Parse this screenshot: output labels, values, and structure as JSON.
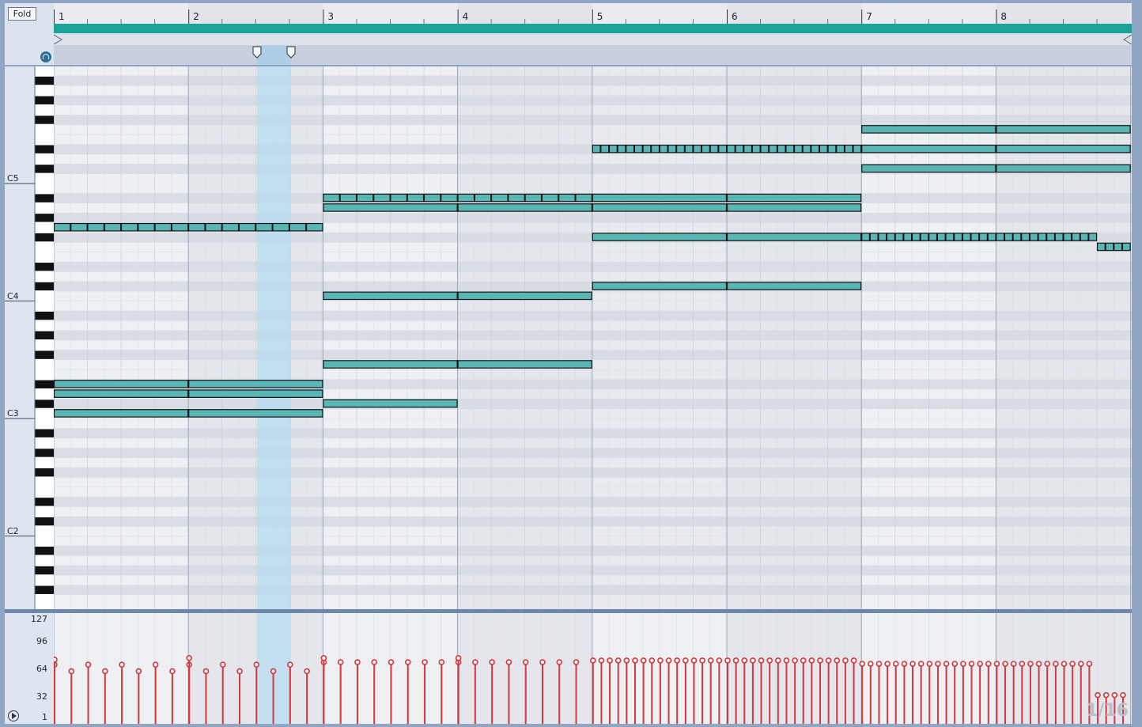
{
  "header": {
    "fold_label": "Fold"
  },
  "ruler": {
    "bars": [
      "1",
      "2",
      "3",
      "4",
      "5",
      "6",
      "7",
      "8"
    ]
  },
  "keyboard": {
    "octave_labels": [
      "C5",
      "C4",
      "C3",
      "C2"
    ]
  },
  "velocity": {
    "axis_labels": [
      "127",
      "96",
      "64",
      "32",
      "1"
    ]
  },
  "grid_quantization": "1/16",
  "icons": [
    "headphones-icon",
    "play-icon",
    "loop-start-icon",
    "loop-end-icon",
    "start-marker-icon",
    "end-marker-icon"
  ],
  "colors": {
    "note": "#5ab6b5",
    "loop": "#1aa39b",
    "velocity": "#d2393c",
    "selection": "#bfe1f3"
  },
  "notes": [
    {
      "pitch": "G4",
      "start": 1,
      "end": 3,
      "split": 16
    },
    {
      "pitch": "D#3",
      "start": 1,
      "end": 2
    },
    {
      "pitch": "D#3",
      "start": 2,
      "end": 3
    },
    {
      "pitch": "D3",
      "start": 1,
      "end": 2
    },
    {
      "pitch": "D3",
      "start": 2,
      "end": 3
    },
    {
      "pitch": "C3",
      "start": 1,
      "end": 2
    },
    {
      "pitch": "C3",
      "start": 2,
      "end": 3
    },
    {
      "pitch": "A#4",
      "start": 3,
      "end": 5,
      "split": 16
    },
    {
      "pitch": "A4",
      "start": 3,
      "end": 4
    },
    {
      "pitch": "A4",
      "start": 4,
      "end": 5
    },
    {
      "pitch": "C4",
      "start": 3,
      "end": 4
    },
    {
      "pitch": "C4",
      "start": 4,
      "end": 5
    },
    {
      "pitch": "F3",
      "start": 3,
      "end": 4
    },
    {
      "pitch": "F3",
      "start": 4,
      "end": 5
    },
    {
      "pitch": "C#3 ",
      "start": 3,
      "end": 4
    },
    {
      "pitch": "D#5",
      "start": 5,
      "end": 7,
      "split": 32
    },
    {
      "pitch": "A#4",
      "start": 5,
      "end": 6
    },
    {
      "pitch": "A#4",
      "start": 6,
      "end": 7
    },
    {
      "pitch": "A4",
      "start": 5,
      "end": 6
    },
    {
      "pitch": "A4",
      "start": 6,
      "end": 7
    },
    {
      "pitch": "F#4",
      "start": 5,
      "end": 6
    },
    {
      "pitch": "F#4",
      "start": 6,
      "end": 7
    },
    {
      "pitch": "C#4",
      "start": 5,
      "end": 6
    },
    {
      "pitch": "C#4",
      "start": 6,
      "end": 7
    },
    {
      "pitch": "F5",
      "start": 7,
      "end": 8
    },
    {
      "pitch": "F5",
      "start": 8,
      "end": 9
    },
    {
      "pitch": "D#5",
      "start": 7,
      "end": 8
    },
    {
      "pitch": "D#5",
      "start": 8,
      "end": 9
    },
    {
      "pitch": "C#5",
      "start": 7,
      "end": 8
    },
    {
      "pitch": "C#5",
      "start": 8,
      "end": 9
    },
    {
      "pitch": "F#4",
      "start": 7,
      "end": 8.75,
      "split": 28
    },
    {
      "pitch": "F4",
      "start": 8.75,
      "end": 9,
      "split": 4
    }
  ]
}
